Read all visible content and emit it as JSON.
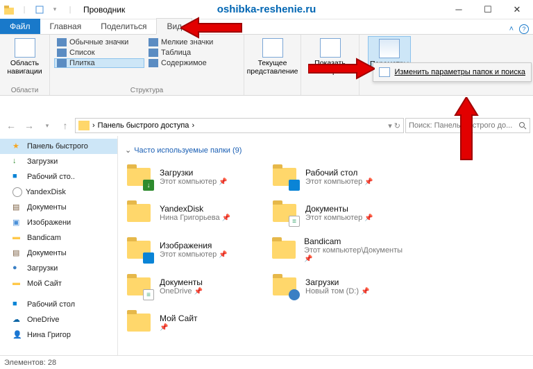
{
  "title": "Проводник",
  "watermark": "oshibka-reshenie.ru",
  "tabs": {
    "file": "Файл",
    "home": "Главная",
    "share": "Поделиться",
    "view": "Вид"
  },
  "ribbon": {
    "nav_pane": "Область навигации",
    "nav_group": "Области",
    "layout_group": "Структура",
    "views": {
      "normal": "Обычные значки",
      "small": "Мелкие значки",
      "list": "Список",
      "table": "Таблица",
      "tile": "Плитка",
      "content": "Содержимое"
    },
    "current_view": "Текущее представление",
    "show_hide": "Показать или скрыть",
    "options": "Параметры",
    "options_item": "Изменить параметры папок и поиска"
  },
  "breadcrumb": {
    "root": "Панель быстрого доступа",
    "sep": "›"
  },
  "search": {
    "placeholder": "Поиск: Панель быстрого до..."
  },
  "sidebar": [
    {
      "label": "Панель быстрого",
      "icon": "star",
      "sel": true
    },
    {
      "label": "Загрузки",
      "icon": "dl"
    },
    {
      "label": "Рабочий сто..",
      "icon": "desk"
    },
    {
      "label": "YandexDisk",
      "icon": "ydisk"
    },
    {
      "label": "Документы",
      "icon": "doc"
    },
    {
      "label": "Изображени",
      "icon": "img"
    },
    {
      "label": "Bandicam",
      "icon": "fold"
    },
    {
      "label": "Документы",
      "icon": "doc"
    },
    {
      "label": "Загрузки",
      "icon": "globe"
    },
    {
      "label": "Мой Сайт",
      "icon": "fold"
    },
    {
      "label": "",
      "icon": "spacer"
    },
    {
      "label": "Рабочий стол",
      "icon": "desk"
    },
    {
      "label": "OneDrive",
      "icon": "od"
    },
    {
      "label": "Нина Григор",
      "icon": "user"
    }
  ],
  "section": "Часто используемые папки (9)",
  "items": [
    {
      "name": "Загрузки",
      "sub": "Этот компьютер",
      "ov": "green",
      "ovtxt": "↓"
    },
    {
      "name": "Рабочий стол",
      "sub": "Этот компьютер",
      "ov": "blue",
      "ovtxt": ""
    },
    {
      "name": "YandexDisk",
      "sub": "Нина Григорьева",
      "ov": "",
      "ovtxt": ""
    },
    {
      "name": "Документы",
      "sub": "Этот компьютер",
      "ov": "doc",
      "ovtxt": "≡"
    },
    {
      "name": "Изображения",
      "sub": "Этот компьютер",
      "ov": "blue",
      "ovtxt": ""
    },
    {
      "name": "Bandicam",
      "sub": "Этот компьютер\\Документы",
      "ov": "",
      "ovtxt": ""
    },
    {
      "name": "Документы",
      "sub": "OneDrive",
      "ov": "doc",
      "ovtxt": "≡"
    },
    {
      "name": "Загрузки",
      "sub": "Новый том (D:)",
      "ov": "globe",
      "ovtxt": ""
    },
    {
      "name": "Мой Сайт",
      "sub": "",
      "ov": "",
      "ovtxt": ""
    }
  ],
  "status": "Элементов: 28"
}
